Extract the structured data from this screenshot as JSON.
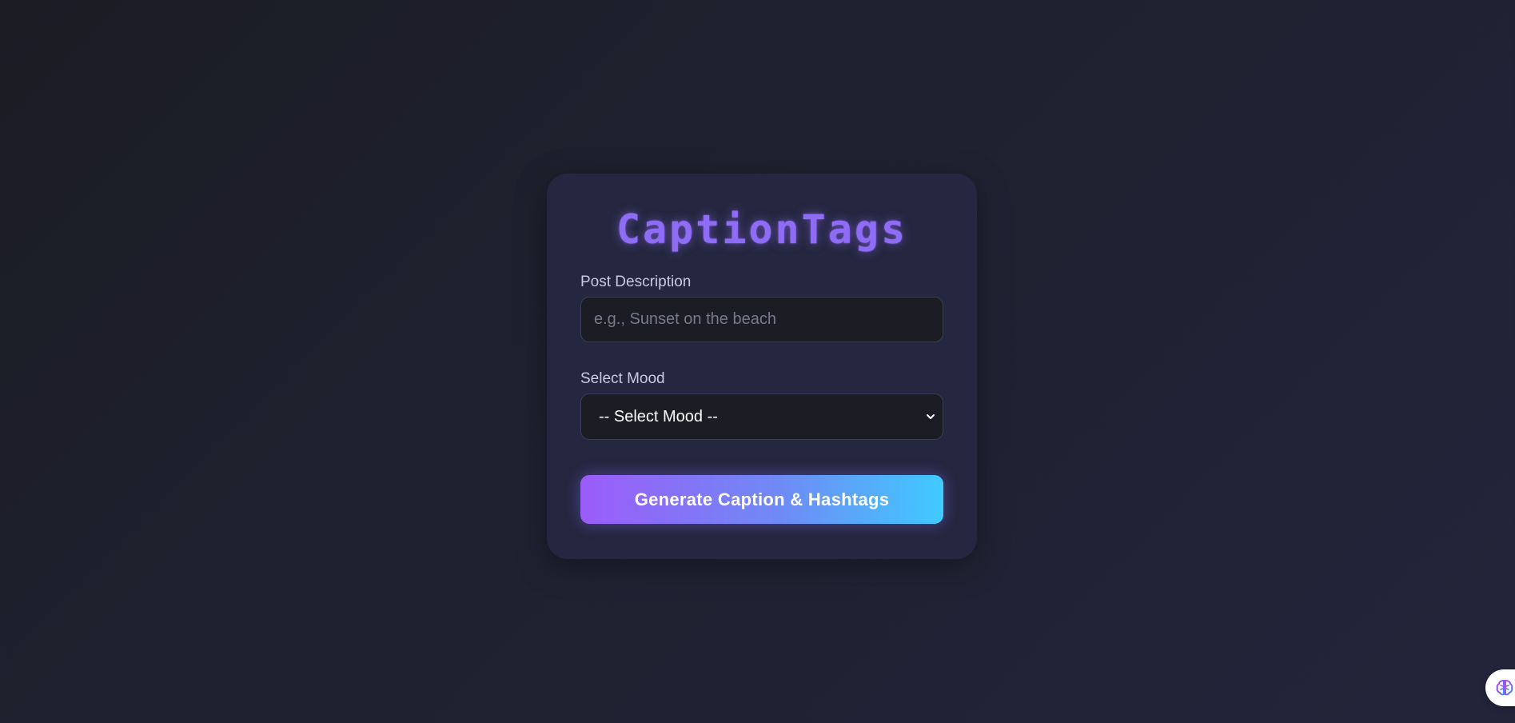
{
  "app": {
    "title": "CaptionTags"
  },
  "form": {
    "description_label": "Post Description",
    "description_placeholder": "e.g., Sunset on the beach",
    "description_value": "",
    "mood_label": "Select Mood",
    "mood_selected": "-- Select Mood --",
    "submit_label": "Generate Caption & Hashtags"
  },
  "widget": {
    "icon": "brain-icon"
  },
  "colors": {
    "background": "#1e1f2c",
    "card": "#252740",
    "accent_purple": "#8f6cf5",
    "gradient_start": "#9b5cf8",
    "gradient_end": "#3fcaff"
  }
}
